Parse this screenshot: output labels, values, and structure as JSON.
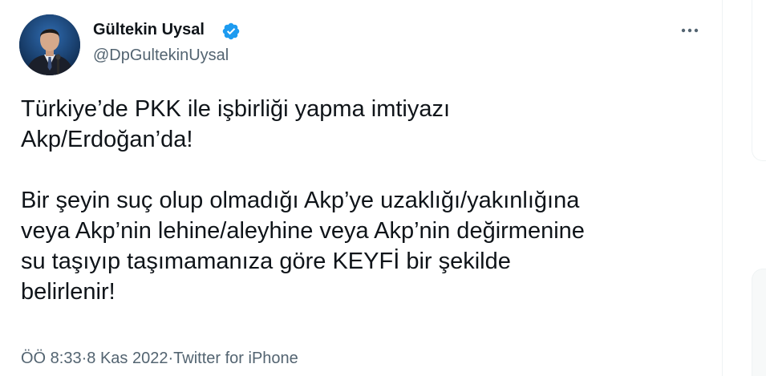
{
  "tweet": {
    "author": {
      "name": "Gültekin Uysal",
      "handle": "@DpGultekinUysal",
      "verified": true,
      "avatar": "person-photo"
    },
    "more_icon": "more-horizontal-icon",
    "paragraphs": [
      "Türkiye’de PKK ile işbirliği yapma imtiyazı\nAkp/Erdoğan’da!",
      "Bir şeyin suç olup olmadığı Akp’ye uzaklığı/yakınlığına\nveya Akp’nin lehine/aleyhine veya Akp’nin değirmenine\nsu taşıyıp taşımamanıza göre KEYFİ bir şekilde\nbelirlenir!"
    ],
    "meta": {
      "time": "ÖÖ 8:33",
      "separator": " · ",
      "date": "8 Kas 2022",
      "source": "Twitter for iPhone"
    }
  },
  "colors": {
    "text_primary": "#0f1419",
    "text_secondary": "#536471",
    "verified_blue": "#1d9bf0",
    "divider": "#eff3f4"
  }
}
